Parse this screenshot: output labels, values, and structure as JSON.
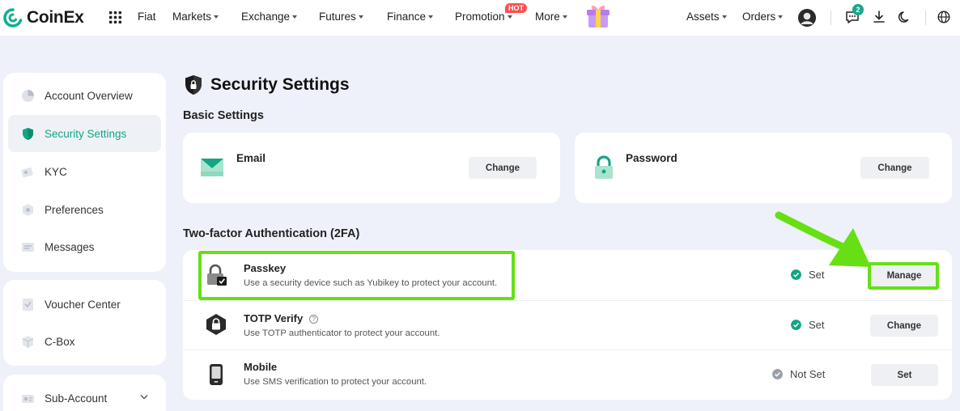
{
  "brand": {
    "name": "CoinEx"
  },
  "nav": {
    "items": [
      {
        "label": "Fiat",
        "dropdown": false
      },
      {
        "label": "Markets",
        "dropdown": true
      },
      {
        "label": "Exchange",
        "dropdown": true
      },
      {
        "label": "Futures",
        "dropdown": true
      },
      {
        "label": "Finance",
        "dropdown": true
      },
      {
        "label": "Promotion",
        "dropdown": true
      },
      {
        "label": "More",
        "dropdown": true
      }
    ],
    "hot_badge": "HOT",
    "right": [
      {
        "label": "Assets",
        "dropdown": true
      },
      {
        "label": "Orders",
        "dropdown": true
      }
    ],
    "notification_count": "2"
  },
  "sidebar": {
    "group1": [
      {
        "label": "Account Overview",
        "icon": "pie-chart-icon",
        "active": false
      },
      {
        "label": "Security Settings",
        "icon": "shield-icon",
        "active": true
      },
      {
        "label": "KYC",
        "icon": "id-card-icon",
        "active": false
      },
      {
        "label": "Preferences",
        "icon": "preferences-icon",
        "active": false
      },
      {
        "label": "Messages",
        "icon": "message-icon",
        "active": false
      }
    ],
    "group2": [
      {
        "label": "Voucher Center",
        "icon": "voucher-icon"
      },
      {
        "label": "C-Box",
        "icon": "box-icon"
      }
    ],
    "group3": [
      {
        "label": "Sub-Account",
        "icon": "sub-account-icon"
      }
    ]
  },
  "page": {
    "title": "Security Settings",
    "basic_title": "Basic Settings",
    "basic": [
      {
        "label": "Email",
        "button": "Change",
        "icon": "email-icon"
      },
      {
        "label": "Password",
        "button": "Change",
        "icon": "lock-icon"
      }
    ],
    "twofa_title": "Two-factor Authentication (2FA)",
    "twofa": [
      {
        "title": "Passkey",
        "desc": "Use a security device such as Yubikey to protect your account.",
        "status": "Set",
        "button": "Manage",
        "icon": "passkey-icon"
      },
      {
        "title": "TOTP Verify",
        "desc": "Use TOTP authenticator to protect your account.",
        "status": "Set",
        "button": "Change",
        "icon": "totp-icon"
      },
      {
        "title": "Mobile",
        "desc": "Use SMS verification to protect your account.",
        "status": "Not Set",
        "button": "Set",
        "icon": "mobile-icon"
      }
    ]
  },
  "colors": {
    "accent": "#13a584",
    "highlight": "#66e014",
    "status_set": "#13a584",
    "status_not_set": "#9aa0a8"
  }
}
